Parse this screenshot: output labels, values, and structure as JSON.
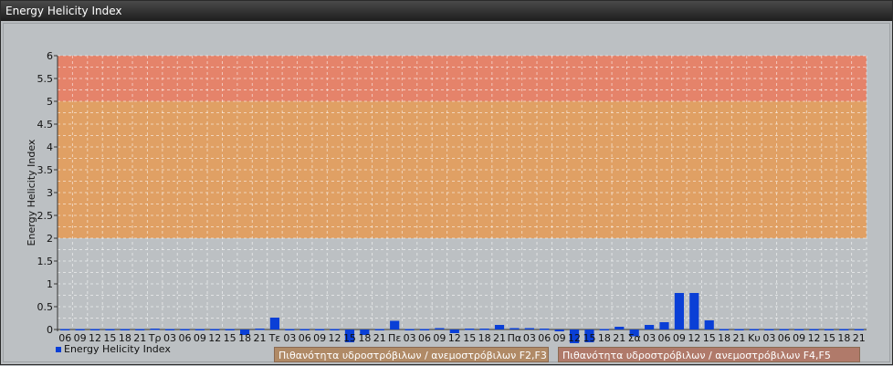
{
  "window": {
    "title": "Energy Helicity Index"
  },
  "chart_data": {
    "type": "bar",
    "ylabel": "Energy Helicity Index",
    "ylim": [
      0,
      6
    ],
    "yticks": [
      "0",
      "0.5",
      "1",
      "1.5",
      "2",
      "2.5",
      "3",
      "3.5",
      "4",
      "4.5",
      "5",
      "5.5",
      "6"
    ],
    "grid": true,
    "bands": [
      {
        "from": 0,
        "to": 2,
        "color": "#bcc0c3",
        "label": ""
      },
      {
        "from": 2,
        "to": 5,
        "color": "#e0a064",
        "label": "Πιθανότητα υδροστρόβιλων / ανεμοστρόβιλων F2,F3"
      },
      {
        "from": 5,
        "to": 6,
        "color": "#e5836a",
        "label": "Πιθανότητα υδροστρόβιλων / ανεμοστρόβιλων F4,F5"
      }
    ],
    "categories": [
      "06",
      "09",
      "12",
      "15",
      "18",
      "21",
      "Τρ",
      "03",
      "06",
      "09",
      "12",
      "15",
      "18",
      "21",
      "Τε",
      "03",
      "06",
      "09",
      "12",
      "15",
      "18",
      "21",
      "Πε",
      "03",
      "06",
      "09",
      "12",
      "15",
      "18",
      "21",
      "Πα",
      "03",
      "06",
      "09",
      "12",
      "15",
      "18",
      "21",
      "Σα",
      "03",
      "06",
      "09",
      "12",
      "15",
      "18",
      "21",
      "Κυ",
      "03",
      "06",
      "09",
      "12",
      "15",
      "18",
      "21"
    ],
    "series": [
      {
        "name": "Energy Helicity Index",
        "color": "#0a3fd6",
        "values": [
          0.01,
          0.01,
          0.01,
          0.01,
          0.01,
          0.01,
          0.02,
          0.01,
          0.01,
          0.01,
          0.01,
          0.01,
          -0.12,
          0.02,
          0.26,
          0.01,
          0.01,
          0.01,
          0.01,
          -0.28,
          -0.12,
          0.01,
          0.19,
          0.01,
          0.01,
          0.03,
          -0.08,
          0.02,
          0.02,
          0.1,
          0.03,
          0.03,
          0.02,
          -0.04,
          -0.3,
          -0.28,
          0.01,
          0.06,
          -0.15,
          0.1,
          0.16,
          0.8,
          0.8,
          0.2,
          0.01,
          0.01,
          0.01,
          0.01,
          0.01,
          0.01,
          0.01,
          0.01,
          0.01,
          0.01
        ]
      }
    ]
  },
  "legend": {
    "series_label": "Energy Helicity Index"
  }
}
